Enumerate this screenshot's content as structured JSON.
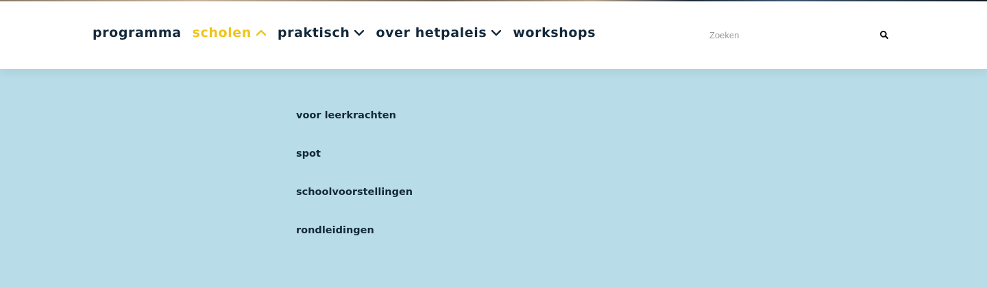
{
  "nav": {
    "items": [
      {
        "label": "programma"
      },
      {
        "label": "scholen"
      },
      {
        "label": "praktisch"
      },
      {
        "label": "over hetpaleis"
      },
      {
        "label": "workshops"
      }
    ]
  },
  "search": {
    "placeholder": "Zoeken",
    "icon": "search-icon"
  },
  "submenu": {
    "items": [
      {
        "label": "voor leerkrachten"
      },
      {
        "label": "spot"
      },
      {
        "label": "schoolvoorstellingen"
      },
      {
        "label": "rondleidingen"
      }
    ]
  },
  "colors": {
    "accent": "#f0c419",
    "text": "#13283a",
    "submenu_bg": "#b8dde8",
    "header_bg": "#ffffff"
  }
}
